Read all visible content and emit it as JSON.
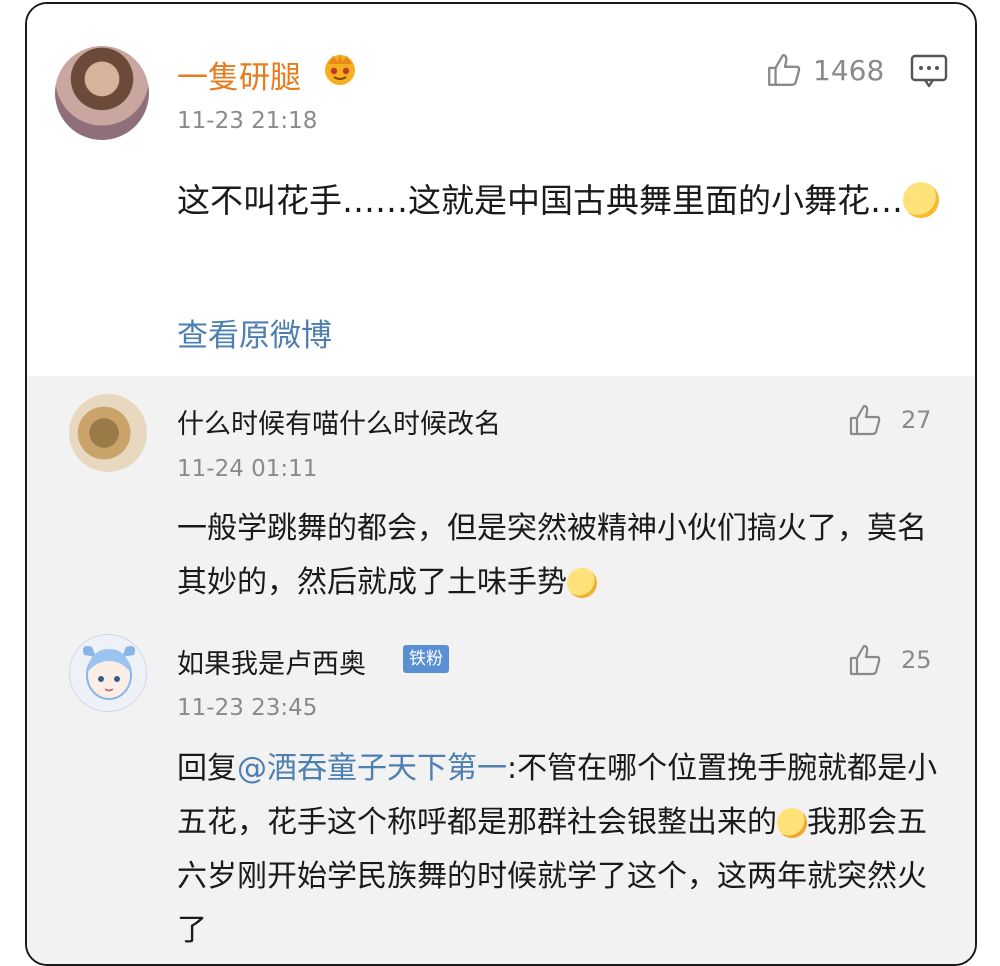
{
  "main_comment": {
    "username": "一隻研腿",
    "timestamp": "11-23 21:18",
    "like_count": "1468",
    "text": "这不叫花手……这就是中国古典舞里面的小舞花…",
    "view_original_label": "查看原微博",
    "icons": {
      "like": "thumbs-up-icon",
      "comment": "comment-icon",
      "badge": "crown-icon",
      "emoji": "sweat-smile-emoji"
    }
  },
  "replies": [
    {
      "username": "什么时候有喵什么时候改名",
      "timestamp": "11-24 01:11",
      "like_count": "27",
      "text": "一般学跳舞的都会，但是突然被精神小伙们搞火了，莫名其妙的，然后就成了土味手势",
      "emoji": "tearful-emoji"
    },
    {
      "username": "如果我是卢西奥",
      "badge": "铁粉",
      "timestamp": "11-23 23:45",
      "like_count": "25",
      "reply_prefix": "回复",
      "mention": "@酒吞童子天下第一",
      "text_part1": ":不管在哪个位置挽手腕就都是小五花，花手这个称呼都是那群社会银整出来的",
      "text_part2": "我那会五六岁刚开始学民族舞的时候就学了这个，这两年就突然火了",
      "emoji": "laughing-tears-emoji"
    }
  ],
  "colors": {
    "username_highlight": "#e87b1e",
    "link": "#4e7fb1",
    "meta_gray": "#8a8a8a",
    "reply_background": "#f2f2f2",
    "badge_background": "#5a8fd4"
  }
}
